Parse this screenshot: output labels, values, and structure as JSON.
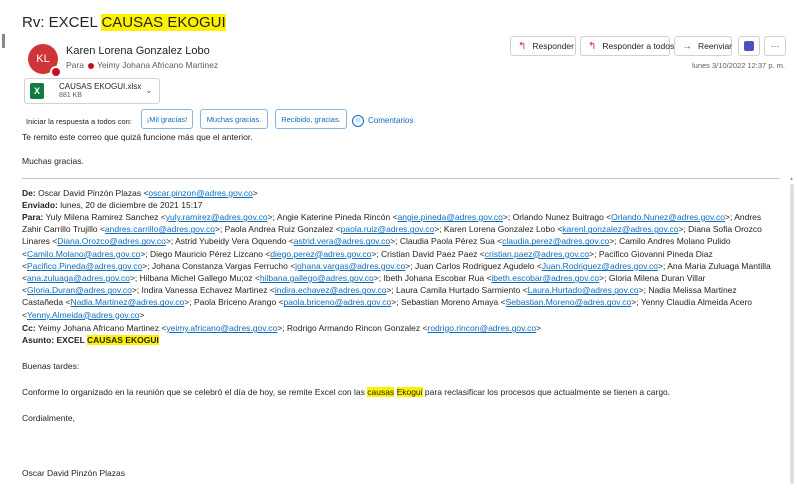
{
  "subject": {
    "prefix": "Rv: EXCEL ",
    "highlight": "CAUSAS EKOGUI"
  },
  "sender": {
    "initials": "KL",
    "name": "Karen Lorena Gonzalez Lobo",
    "to_label": "Para",
    "to_name": "Yeimy Johana Africano Martinez"
  },
  "actions": {
    "reply": "Responder",
    "reply_all": "Responder a todos",
    "forward": "Reenviar",
    "more": "···"
  },
  "timestamp": "lunes 3/10/2022 12:37 p. m.",
  "attachment": {
    "name": "CAUSAS EKOGUI.xlsx",
    "size": "881 KB",
    "icon_label": "X"
  },
  "quick_reply": {
    "label": "Iniciar la respuesta a todos con:",
    "options": [
      "¡Mil gracias!",
      "Muchas gracias.",
      "Recibido, gracias."
    ],
    "comments": "Comentarios"
  },
  "body": {
    "line1": "Te remito este correo que quizá funcione más que el anterior.",
    "line2": "Muchas gracias."
  },
  "forwarded": {
    "from_label": "De:",
    "from_name": "Oscar David Pinzón Plazas",
    "from_email": "oscar.pinzon@adres.gov.co",
    "sent_label": "Enviado:",
    "sent_value": "lunes, 20 de diciembre de 2021 15:17",
    "to_label": "Para:",
    "recipients": [
      {
        "name": "Yuly Milena Ramirez Sanchez",
        "email": "yuly.ramirez@adres.gov.co"
      },
      {
        "name": "Angie Katerine Pineda Rincón",
        "email": "angie.pineda@adres.gov.co"
      },
      {
        "name": "Orlando Nunez Buitrago",
        "email": "Orlando.Nunez@adres.gov.co"
      },
      {
        "name": "Andres Zahir Carrillo Trujillo",
        "email": "andres.carrillo@adres.gov.co"
      },
      {
        "name": "Paola Andrea Ruiz Gonzalez",
        "email": "paola.ruiz@adres.gov.co"
      },
      {
        "name": "Karen Lorena Gonzalez Lobo",
        "email": "karenl.gonzalez@adres.gov.co"
      },
      {
        "name": "Diana Sofia Orozco Linares",
        "email": "Diana.Orozco@adres.gov.co"
      },
      {
        "name": "Astrid Yubeidy Vera Oquendo",
        "email": "astrid.vera@adres.gov.co"
      },
      {
        "name": "Claudia Paola Pérez Sua",
        "email": "claudia.perez@adres.gov.co"
      },
      {
        "name": "Camilo Andres Molano Pulido",
        "email": "Camilo.Molano@adres.gov.co"
      },
      {
        "name": "Diego Mauricio Pérez Lizcano",
        "email": "diego.perez@adres.gov.co"
      },
      {
        "name": "Cristian David Paez Paez",
        "email": "cristian.paez@adres.gov.co"
      },
      {
        "name": "Pacifico Giovanni Pineda Diaz",
        "email": "Pacifico.Pineda@adres.gov.co"
      },
      {
        "name": "Johana Constanza Vargas Ferrucho",
        "email": "johana.vargas@adres.gov.co"
      },
      {
        "name": "Juan Carlos Rodriguez Agudelo",
        "email": "Juan.Rodriguez@adres.gov.co"
      },
      {
        "name": "Ana Maria Zuluaga Mantilla",
        "email": "ana.zuluaga@adres.gov.co"
      },
      {
        "name": "Hilbana Michel Gallego Mu;oz",
        "email": "hilbana.gallego@adres.gov.co"
      },
      {
        "name": "Ibeth Johana Escobar Rua",
        "email": "ibeth.escobar@adres.gov.co"
      },
      {
        "name": "Gloria Milena Duran Villar",
        "email": "Gloria.Duran@adres.gov.co"
      },
      {
        "name": "Indira Vanessa Echavez Martinez",
        "email": "indira.echavez@adres.gov.co"
      },
      {
        "name": "Laura Camila Hurtado Sarmiento",
        "email": "Laura.Hurtado@adres.gov.co"
      },
      {
        "name": "Nadia Melissa Martinez Castañeda",
        "email": "Nadia.Martinez@adres.gov.co"
      },
      {
        "name": "Paola Briceno Arango",
        "email": "paola.briceno@adres.gov.co"
      },
      {
        "name": "Sebastian Moreno Amaya",
        "email": "Sebastian.Moreno@adres.gov.co"
      },
      {
        "name": "Yenny Claudia Almeida Acero",
        "email": "Yenny.Almeida@adres.gov.co"
      }
    ],
    "cc_label": "Cc:",
    "cc": [
      {
        "name": "Yeimy Johana Africano Martinez",
        "email": "yeimy.africano@adres.gov.co"
      },
      {
        "name": "Rodrigo Armando Rincon Gonzalez",
        "email": "rodrigo.rincon@adres.gov.co"
      }
    ],
    "subject_label": "Asunto:",
    "subject_prefix": "EXCEL ",
    "subject_highlight": "CAUSAS EKOGUI",
    "greeting": "Buenas tardes:",
    "message_before": "Conforme lo organizado en la reunión que se celebró el día de hoy, se remite Excel con las ",
    "message_hl1": "causas",
    "message_hl2": "Ekogui",
    "message_after": " para reclasificar los procesos que actualmente se tienen a cargo.",
    "closing": "Cordialmente,",
    "signature": "Oscar David Pinzón Plazas"
  },
  "colors": {
    "accent": "#0f6cbd",
    "highlight": "#fff100",
    "avatar": "#d13438",
    "excel": "#107c41"
  }
}
